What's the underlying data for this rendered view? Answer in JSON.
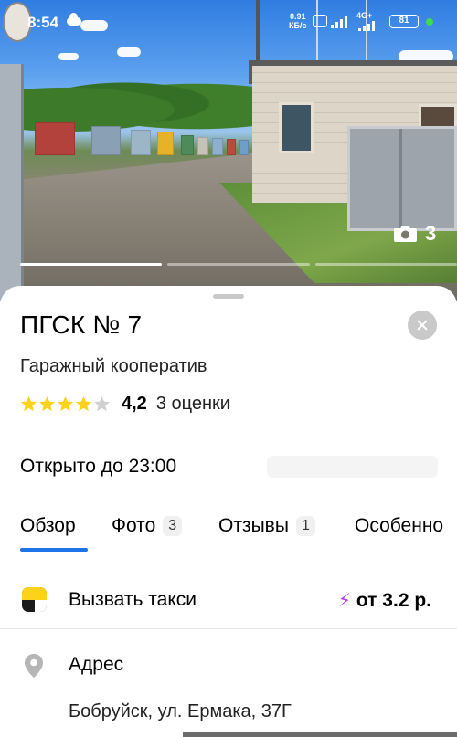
{
  "status_bar": {
    "time": "8:54",
    "net_speed_value": "0.91",
    "net_speed_unit": "КБ/с",
    "badge_1": "VoLTE",
    "lte": "4G+",
    "battery": "81",
    "weather_icon": "cloud-icon"
  },
  "photo": {
    "count": "3",
    "camera_icon": "camera-icon",
    "gallery_progress": {
      "active_index": 0,
      "total": 3
    }
  },
  "place": {
    "title": "ПГСК № 7",
    "category": "Гаражный кооператив",
    "rating_value": "4,2",
    "rating_stars": 4.2,
    "reviews_link": "3 оценки",
    "hours": "Открыто до 23:00"
  },
  "tabs": [
    {
      "label": "Обзор",
      "count": ""
    },
    {
      "label": "Фото",
      "count": "3"
    },
    {
      "label": "Отзывы",
      "count": "1"
    },
    {
      "label": "Особенно",
      "count": ""
    }
  ],
  "taxi": {
    "label": "Вызвать такси",
    "price": "от 3.2 р."
  },
  "address": {
    "label": "Адрес",
    "value": "Бобруйск, ул. Ермака, 37Г"
  },
  "colors": {
    "accent_blue": "#1e73e8",
    "star_yellow": "#fdd21b",
    "star_grey": "#d0d0d0",
    "taxi_yellow": "#fdd21b",
    "bolt_purple": "#b83be6"
  }
}
